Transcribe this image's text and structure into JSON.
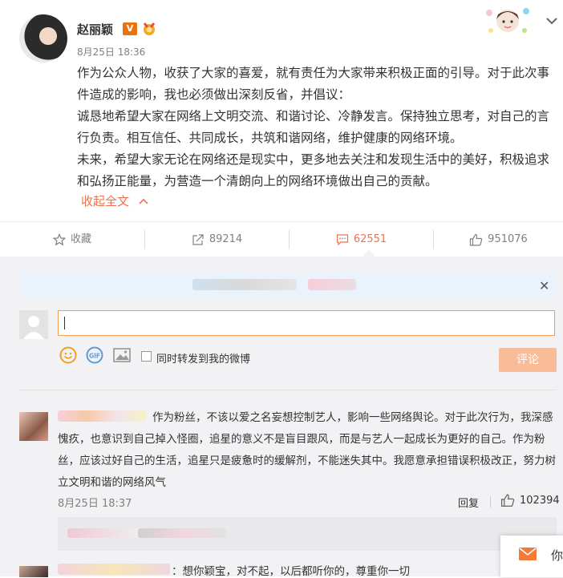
{
  "post": {
    "author": "赵丽颖",
    "verified_badge": "V",
    "time": "8月25日 18:36",
    "paragraphs": [
      "作为公众人物，收获了大家的喜爱，就有责任为大家带来积极正面的引导。对于此次事件造成的影响，我也必须做出深刻反省，并倡议：",
      "诚恳地希望大家在网络上文明交流、和谐讨论、冷静发言。保持独立思考，对自己的言行负责。相互信任、共同成长，共筑和谐网络，维护健康的网络环境。",
      "未来，希望大家无论在网络还是现实中，更多地去关注和发现生活中的美好，积极追求和弘扬正能量，为营造一个清朗向上的网络环境做出自己的贡献。"
    ],
    "collapse_label": "收起全文"
  },
  "actions": {
    "favorite": "收藏",
    "repost": "89214",
    "comment": "62551",
    "like": "951076"
  },
  "composer": {
    "checkbox_label": "同时转发到我的微博",
    "submit_label": "评论"
  },
  "comments": [
    {
      "text": "作为粉丝，不该以爱之名妄想控制艺人，影响一些网络舆论。对于此次行为，我深感愧疚，也意识到自己掉入怪圈，追星的意义不是盲目跟风，而是与艺人一起成长为更好的自己。作为粉丝，应该过好自己的生活，追星只是疲惫时的缓解剂，不能迷失其中。我愿意承担错误积极改正，努力树立文明和谐的网络风气",
      "time": "8月25日 18:37",
      "reply_label": "回复",
      "likes": "102394"
    },
    {
      "text": "：想你颖宝，对不起，以后都听你的，尊重你一切"
    }
  ],
  "floating": {
    "text": "你"
  },
  "colors": {
    "accent": "#eb7350",
    "comment_active": "#eb7350",
    "submit_disabled": "#f8bd98",
    "panel_bg": "#f2f2f5"
  }
}
